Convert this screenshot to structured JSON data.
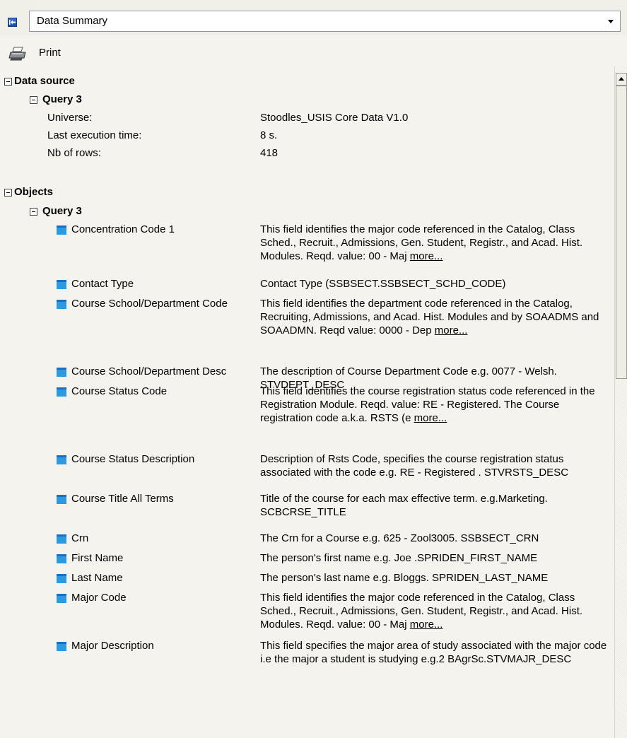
{
  "header": {
    "view_title": "Data Summary",
    "print_label": "Print"
  },
  "data_source": {
    "title": "Data source",
    "query_title": "Query 3",
    "properties": [
      {
        "label": "Universe:",
        "value": "Stoodles_USIS Core Data V1.0"
      },
      {
        "label": "Last execution time:",
        "value": "8 s."
      },
      {
        "label": "Nb of rows:",
        "value": "418"
      }
    ]
  },
  "objects": {
    "title": "Objects",
    "query_title": "Query 3",
    "items": [
      {
        "name": "Concentration Code 1",
        "description": "This field identifies the major code referenced in the Catalog, Class Sched., Recruit., Admissions, Gen. Student, Registr., and Acad. Hist. Modules. Reqd. value: 00 - Maj",
        "more": "more..."
      },
      {
        "name": "Contact Type",
        "description": "Contact Type (SSBSECT.SSBSECT_SCHD_CODE)",
        "more": ""
      },
      {
        "name": "Course School/Department Code",
        "description": "This field identifies the department code referenced in the Catalog, Recruiting, Admissions, and Acad. Hist. Modules and by SOAADMS and SOAADMN. Reqd value: 0000 - Dep",
        "more": "more..."
      },
      {
        "name": "Course School/Department Desc",
        "description": "The description of Course Department Code e.g. 0077 - Welsh. STVDEPT_DESC",
        "more": ""
      },
      {
        "name": "Course Status Code",
        "description": "This field identifies the course registration status code referenced in the Registration Module. Reqd. value: RE - Registered. The Course registration code a.k.a. RSTS (e",
        "more": "more..."
      },
      {
        "name": "Course Status Description",
        "description": "Description of Rsts Code, specifies the course registration status associated with the code e.g. RE - Registered . STVRSTS_DESC",
        "more": ""
      },
      {
        "name": "Course Title All Terms",
        "description": "Title of the course for each max effective term. e.g.Marketing. SCBCRSE_TITLE",
        "more": ""
      },
      {
        "name": "Crn",
        "description": "The Crn for a Course e.g. 625 - Zool3005. SSBSECT_CRN",
        "more": ""
      },
      {
        "name": "First Name",
        "description": "The person's first name e.g. Joe .SPRIDEN_FIRST_NAME",
        "more": ""
      },
      {
        "name": "Last Name",
        "description": "The person's last name e.g. Bloggs. SPRIDEN_LAST_NAME",
        "more": ""
      },
      {
        "name": "Major Code",
        "description": "This field identifies the major code referenced in the Catalog, Class Sched., Recruit., Admissions, Gen. Student, Registr., and Acad. Hist. Modules. Reqd. value: 00 - Maj",
        "more": "more..."
      },
      {
        "name": "Major Description",
        "description": "This field specifies the major area of study associated with the major code i.e the major a student is studying e.g.2 BAgrSc.STVMAJR_DESC",
        "more": ""
      }
    ]
  }
}
